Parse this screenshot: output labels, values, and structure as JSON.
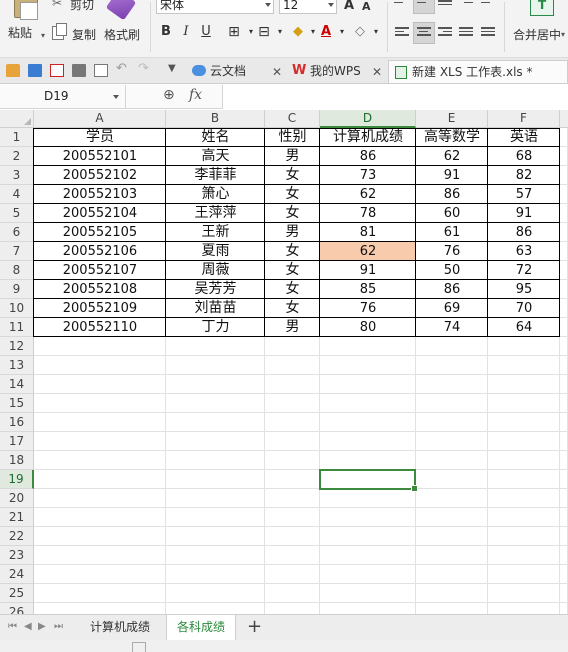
{
  "ribbon": {
    "cut_label": "剪切",
    "paste_label": "粘贴",
    "copy_label": "复制",
    "format_painter_label": "格式刷",
    "font_name": "宋体",
    "font_size": "12",
    "bold": "B",
    "italic": "I",
    "underline": "U",
    "grow_font": "A",
    "shrink_font": "A",
    "merge_label": "合并居中"
  },
  "tabs": {
    "cloud_docs": "云文档",
    "my_wps": "我的WPS",
    "active_file": "新建 XLS 工作表.xls *"
  },
  "formula_bar": {
    "name_box": "D19",
    "fx": "fx",
    "content": ""
  },
  "columns": [
    "A",
    "B",
    "C",
    "D",
    "E",
    "F"
  ],
  "rows": [
    "1",
    "2",
    "3",
    "4",
    "5",
    "6",
    "7",
    "8",
    "9",
    "10",
    "11",
    "12",
    "13",
    "14",
    "15",
    "16",
    "17",
    "18",
    "19",
    "20",
    "21",
    "22",
    "23",
    "24",
    "25",
    "26"
  ],
  "table": {
    "headers": [
      "学员",
      "姓名",
      "性别",
      "计算机成绩",
      "高等数学",
      "英语"
    ],
    "records": [
      [
        "200552101",
        "高天",
        "男",
        "86",
        "62",
        "68"
      ],
      [
        "200552102",
        "李菲菲",
        "女",
        "73",
        "91",
        "82"
      ],
      [
        "200552103",
        "箫心",
        "女",
        "62",
        "86",
        "57"
      ],
      [
        "200552104",
        "王萍萍",
        "女",
        "78",
        "60",
        "91"
      ],
      [
        "200552105",
        "王新",
        "男",
        "81",
        "61",
        "86"
      ],
      [
        "200552106",
        "夏雨",
        "女",
        "62",
        "76",
        "63"
      ],
      [
        "200552107",
        "周薇",
        "女",
        "91",
        "50",
        "72"
      ],
      [
        "200552108",
        "吴芳芳",
        "女",
        "85",
        "86",
        "95"
      ],
      [
        "200552109",
        "刘苗苗",
        "女",
        "76",
        "69",
        "70"
      ],
      [
        "200552110",
        "丁力",
        "男",
        "80",
        "74",
        "64"
      ]
    ]
  },
  "highlight_color": "#f8cbad",
  "accent_color": "#3b8a3e",
  "selected_cell": "D19",
  "sheets": [
    "计算机成绩",
    "各科成绩"
  ],
  "active_sheet": "各科成绩",
  "add_sheet": "+"
}
